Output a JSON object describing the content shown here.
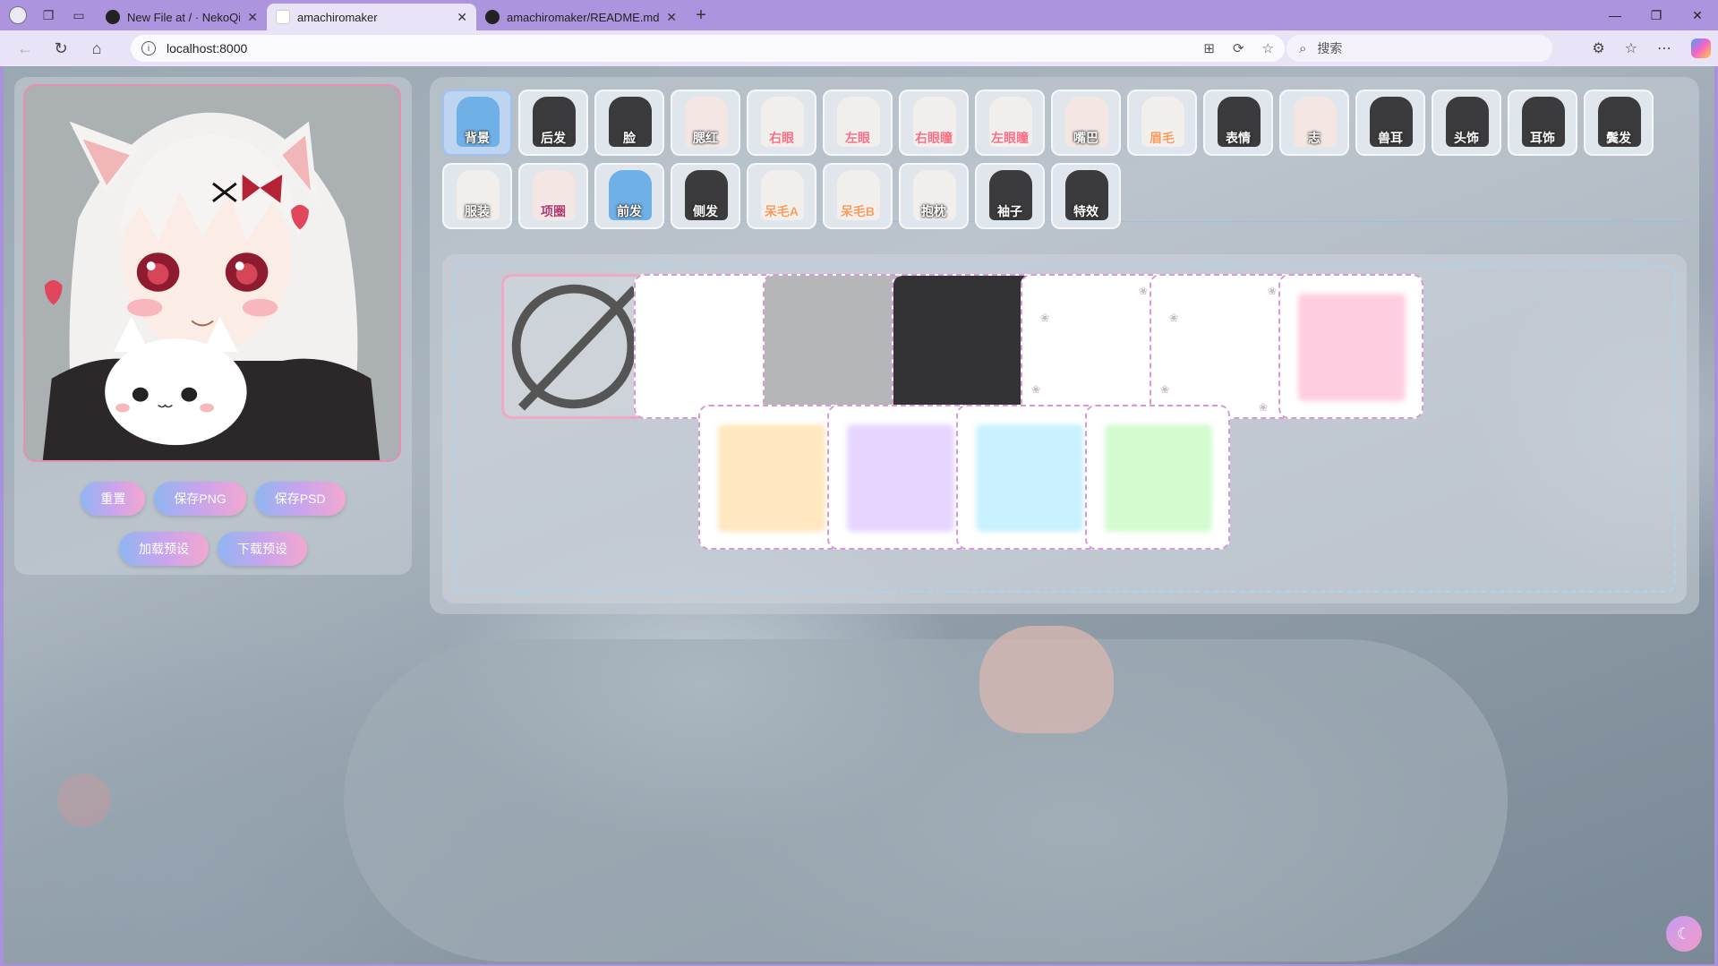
{
  "browser": {
    "tabs": [
      {
        "title": "New File at / · NekoQiye/RE-Ama",
        "active": false,
        "icon": "github-icon"
      },
      {
        "title": "amachiromaker",
        "active": true,
        "icon": "page-icon"
      },
      {
        "title": "amachiromaker/README.md at m",
        "active": false,
        "icon": "github-icon"
      }
    ],
    "url": "localhost:8000",
    "search_placeholder": "搜索"
  },
  "actions": {
    "reset": "重置",
    "save_png": "保存PNG",
    "save_psd": "保存PSD",
    "load_preset": "加载预设",
    "download_preset": "下载预设"
  },
  "categories_row1": [
    {
      "label": "背景",
      "style": "white",
      "thumb": "blue",
      "active": true
    },
    {
      "label": "后发",
      "style": "white",
      "thumb": "dark"
    },
    {
      "label": "脸",
      "style": "white",
      "thumb": "dark"
    },
    {
      "label": "腮红",
      "style": "white",
      "thumb": "face"
    },
    {
      "label": "右眼",
      "style": "red",
      "thumb": "light"
    },
    {
      "label": "左眼",
      "style": "red",
      "thumb": "light"
    },
    {
      "label": "右眼瞳",
      "style": "red",
      "thumb": "light"
    },
    {
      "label": "左眼瞳",
      "style": "red",
      "thumb": "light"
    },
    {
      "label": "嘴巴",
      "style": "white",
      "thumb": "face"
    },
    {
      "label": "眉毛",
      "style": "orange",
      "thumb": "light"
    },
    {
      "label": "表情",
      "style": "white",
      "thumb": "dark"
    },
    {
      "label": "志",
      "style": "white",
      "thumb": "face"
    },
    {
      "label": "兽耳",
      "style": "white",
      "thumb": "dark"
    },
    {
      "label": "头饰",
      "style": "white",
      "thumb": "dark"
    },
    {
      "label": "耳饰",
      "style": "white",
      "thumb": "dark"
    },
    {
      "label": "鬓发",
      "style": "white",
      "thumb": "dark"
    }
  ],
  "categories_row2": [
    {
      "label": "服装",
      "style": "white",
      "thumb": "light"
    },
    {
      "label": "项圈",
      "style": "mag",
      "thumb": "face"
    },
    {
      "label": "前发",
      "style": "white",
      "thumb": "blue"
    },
    {
      "label": "侧发",
      "style": "white",
      "thumb": "dark"
    },
    {
      "label": "呆毛A",
      "style": "orange",
      "thumb": "light"
    },
    {
      "label": "呆毛B",
      "style": "orange",
      "thumb": "light"
    },
    {
      "label": "抱枕",
      "style": "white",
      "thumb": "light"
    },
    {
      "label": "袖子",
      "style": "white",
      "thumb": "dark"
    },
    {
      "label": "特效",
      "style": "white",
      "thumb": "dark"
    }
  ],
  "background_options": [
    {
      "name": "none",
      "color": ""
    },
    {
      "name": "white",
      "color": "#ffffff"
    },
    {
      "name": "gray",
      "color": "#b4b6b8"
    },
    {
      "name": "black",
      "color": "#333335"
    },
    {
      "name": "paw-white",
      "color": "#ffffff"
    },
    {
      "name": "paw-white-2",
      "color": "#ffffff"
    },
    {
      "name": "pink",
      "color": "#ffcde0"
    },
    {
      "name": "peach",
      "color": "#ffe7bf"
    },
    {
      "name": "lavender",
      "color": "#e6d6ff"
    },
    {
      "name": "sky",
      "color": "#c9f1ff"
    },
    {
      "name": "mint",
      "color": "#d3fbd0"
    }
  ]
}
